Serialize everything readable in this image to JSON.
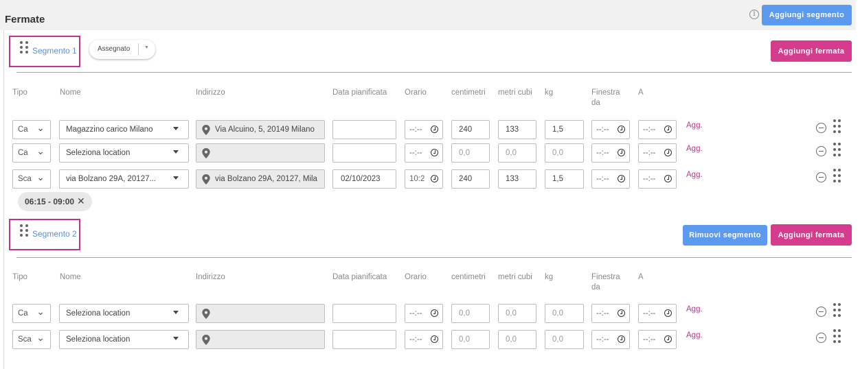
{
  "header": {
    "title": "Fermate",
    "add_segment_label": "Aggiungi segmento",
    "info_icon": "info-icon"
  },
  "columns": [
    "Tipo",
    "Nome",
    "Indirizzo",
    "Data pianificata",
    "Orario",
    "centimetri",
    "metri cubi",
    "kg",
    "Finestra da",
    "A"
  ],
  "segments": [
    {
      "label": "Segmento 1",
      "status": "Assegnato",
      "add_stop_label": "Aggiungi fermata",
      "rows": [
        {
          "tipo": "Ca",
          "nome": "Magazzino carico Milano",
          "indirizzo": "Via Alcuino, 5, 20149 Milano",
          "data": "",
          "orario": "--:--",
          "cm": "240",
          "mc": "133",
          "kg": "1,5",
          "finestra_da": "--:--",
          "a": "--:--",
          "agg": "Agg."
        },
        {
          "tipo": "Ca",
          "nome": "Seleziona location",
          "indirizzo": "",
          "data": "",
          "orario": "--:--",
          "cm": "0,0",
          "mc": "0,0",
          "kg": "0,0",
          "finestra_da": "--:--",
          "a": "--:--",
          "agg": "Agg."
        },
        {
          "tipo": "Sca",
          "nome": "via Bolzano 29A, 20127...",
          "indirizzo": "via Bolzano 29A, 20127, Mila",
          "data": "02/10/2023",
          "orario": "10:2",
          "cm": "240",
          "mc": "133",
          "kg": "1,5",
          "finestra_da": "--:--",
          "a": "--:--",
          "agg": "Agg."
        }
      ],
      "time_chip": "06:15 - 09:00"
    },
    {
      "label": "Segmento 2",
      "remove_label": "Rimuovi segmento",
      "add_stop_label": "Aggiungi fermata",
      "rows": [
        {
          "tipo": "Ca",
          "nome": "Seleziona location",
          "indirizzo": "",
          "data": "",
          "orario": "--:--",
          "cm": "0,0",
          "mc": "0,0",
          "kg": "0,0",
          "finestra_da": "--:--",
          "a": "--:--",
          "agg": "Agg."
        },
        {
          "tipo": "Sca",
          "nome": "Seleziona location",
          "indirizzo": "",
          "data": "",
          "orario": "--:--",
          "cm": "0,0",
          "mc": "0,0",
          "kg": "0,0",
          "finestra_da": "--:--",
          "a": "--:--",
          "agg": "Agg."
        }
      ]
    }
  ],
  "colors": {
    "primary_blue": "#5c9af0",
    "accent_pink": "#d63c8d",
    "link_blue": "#5c8fd6",
    "highlight_border": "#c2338f"
  }
}
